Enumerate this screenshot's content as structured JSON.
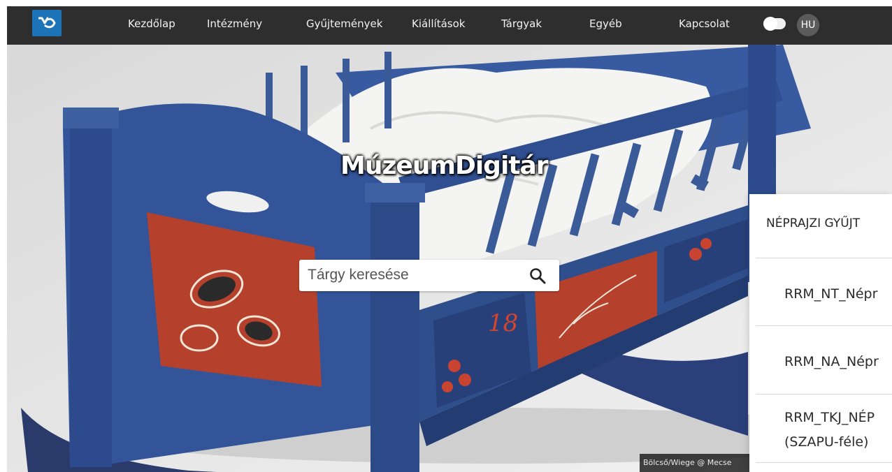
{
  "nav": {
    "logo_alt": "MúzeumDigitár logo",
    "links": [
      "Kezdőlap",
      "Intézmény",
      "Gyűjtemények",
      "Kiállítások",
      "Tárgyak",
      "Egyéb",
      "Kapcsolat"
    ],
    "lang": "HU"
  },
  "hero": {
    "title": "MúzeumDigitár",
    "search_placeholder": "Tárgy keresése",
    "credit": "Bölcső/Wiege @ Mecse"
  },
  "panel": {
    "heading": "NÉPRAJZI GYŰJT",
    "items": [
      "RRM_NT_Népr",
      "RRM_NA_Népr",
      "RRM_TKJ_NÉP",
      "(SZAPU-féle)"
    ]
  },
  "colors": {
    "navbar_bg": "#2e2e2e",
    "logo_bg": "#1d73b8",
    "cradle_blue": "#2e4e8c",
    "panel_red": "#b5412d"
  }
}
